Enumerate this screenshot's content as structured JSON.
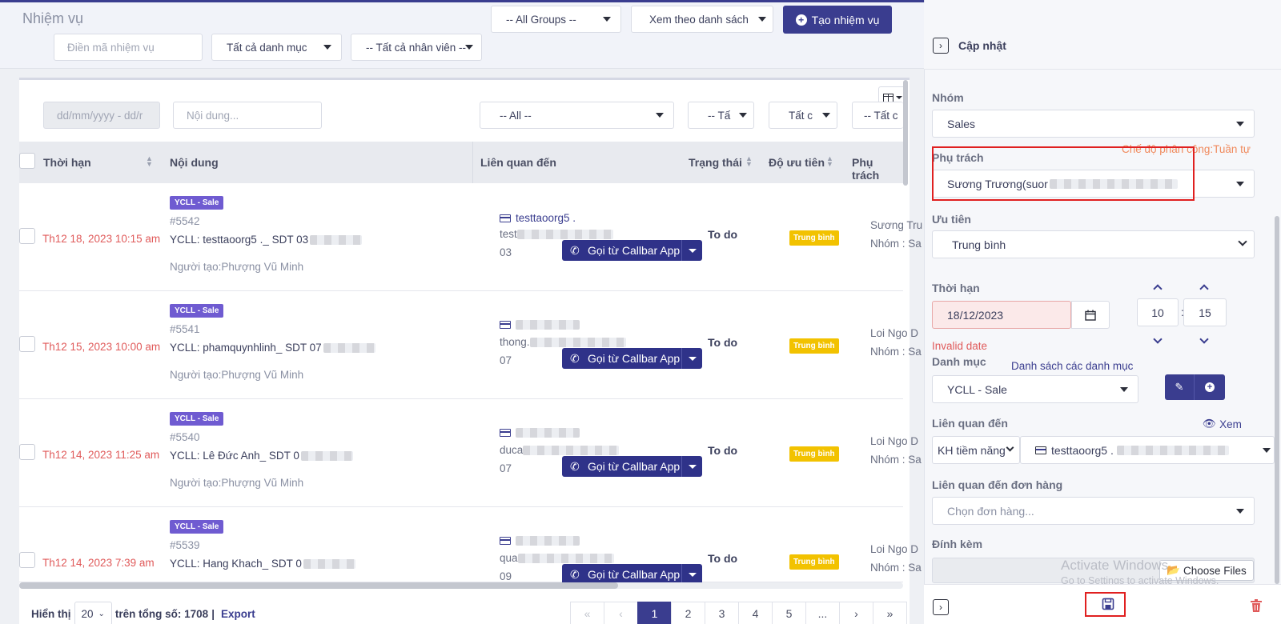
{
  "header": {
    "title": "Nhiệm vụ",
    "groups_select": "-- All Groups --",
    "view_mode_select": "Xem theo danh sách",
    "create_button": "Tạo nhiệm vụ",
    "task_code_placeholder": "Điền mã nhiệm vụ",
    "category_select": "Tất cả danh mục",
    "staff_select": "-- Tất cả nhân viên --"
  },
  "filters": {
    "date_placeholder": "dd/mm/yyyy - dd/r",
    "content_placeholder": "Nội dung...",
    "related_select": "-- All --",
    "status_select": "-- Tấ",
    "priority_select": "Tất c",
    "owner_select": "-- Tất c"
  },
  "table": {
    "columns": [
      "Thời hạn",
      "Nội dung",
      "Liên quan đến",
      "Trạng thái",
      "Độ ưu tiên",
      "Phụ trách"
    ],
    "call_button_label": "Gọi từ Callbar App",
    "rows": [
      {
        "deadline": "Th12 18, 2023 10:15 am",
        "badge": "YCLL - Sale",
        "id": "#5542",
        "content": "YCLL: testtaoorg5 ._ SDT 03",
        "creator": "Người tạo:Phượng Vũ Minh",
        "related_name": "testtaoorg5 .",
        "related_email": "test",
        "related_phone": "03",
        "status": "To do",
        "priority": "Trung bình",
        "owner": "Sương Tru",
        "owner_group": "Nhóm : Sa"
      },
      {
        "deadline": "Th12 15, 2023 10:00 am",
        "badge": "YCLL - Sale",
        "id": "#5541",
        "content": "YCLL: phamquynhlinh_ SDT 07",
        "creator": "Người tạo:Phượng Vũ Minh",
        "related_name": "",
        "related_email": "thong.",
        "related_phone": "07",
        "status": "To do",
        "priority": "Trung bình",
        "owner": "Loi Ngo D",
        "owner_group": "Nhóm : Sa"
      },
      {
        "deadline": "Th12 14, 2023 11:25 am",
        "badge": "YCLL - Sale",
        "id": "#5540",
        "content": "YCLL: Lê Đức Anh_ SDT 0",
        "creator": "Người tạo:Phượng Vũ Minh",
        "related_name": "",
        "related_email": "duca",
        "related_phone": "07",
        "status": "To do",
        "priority": "Trung bình",
        "owner": "Loi Ngo D",
        "owner_group": "Nhóm : Sa"
      },
      {
        "deadline": "Th12 14, 2023 7:39 am",
        "badge": "YCLL - Sale",
        "id": "#5539",
        "content": "YCLL: Hang Khach_ SDT 0",
        "creator": "",
        "related_name": "",
        "related_email": "qua",
        "related_phone": "09",
        "status": "To do",
        "priority": "Trung bình",
        "owner": "Loi Ngo D",
        "owner_group": "Nhóm : Sa"
      }
    ]
  },
  "footer": {
    "show_label": "Hiển thị",
    "page_size": "20",
    "total_label": "trên tổng số: 1708",
    "separator": "|",
    "export_label": "Export",
    "pages": [
      "«",
      "‹",
      "1",
      "2",
      "3",
      "4",
      "5",
      "...",
      "›",
      "»"
    ]
  },
  "panel": {
    "title": "Cập nhật",
    "group_label": "Nhóm",
    "group_value": "Sales",
    "owner_label": "Phụ trách",
    "assign_mode": "Chế độ phân công:Tuần tự",
    "owner_value": "Sương Trương(suor",
    "priority_label": "Ưu tiên",
    "priority_value": "Trung bình",
    "deadline_label": "Thời hạn",
    "deadline_value": "18/12/2023",
    "hour": "10",
    "minute": "15",
    "time_sep": ":",
    "invalid_text": "Invalid date",
    "category_label": "Danh mục",
    "category_list_link": "Danh sách các danh mục",
    "category_value": "YCLL - Sale",
    "related_label": "Liên quan đến",
    "view_link": "Xem",
    "related_type": "KH tiềm năng",
    "related_value": "testtaoorg5 .",
    "order_label": "Liên quan đến đơn hàng",
    "order_placeholder": "Chọn đơn hàng...",
    "attach_label": "Đính kèm",
    "choose_files": "Choose Files",
    "watermark_title": "Activate Windows",
    "watermark_sub": "Go to Settings to activate Windows."
  },
  "colors": {
    "primary": "#3a3d8f",
    "danger": "#e05a5a",
    "badge": "#6f5bd1",
    "priority": "#f2c200",
    "highlight": "#e02020"
  }
}
